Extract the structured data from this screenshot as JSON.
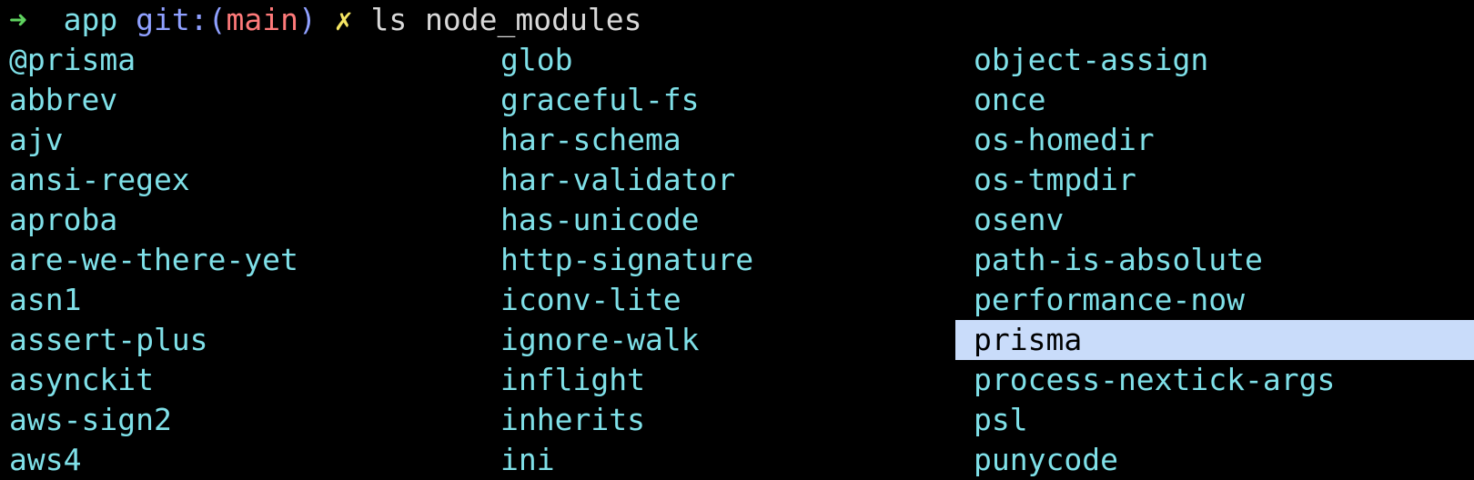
{
  "prompt": {
    "arrow": "➜",
    "directory": "app",
    "git_label": "git:",
    "paren_open": "(",
    "branch": "main",
    "paren_close": ")",
    "dirty_marker": "✗",
    "command": "ls node_modules"
  },
  "listing": {
    "column_1": [
      "@prisma",
      "abbrev",
      "ajv",
      "ansi-regex",
      "aproba",
      "are-we-there-yet",
      "asn1",
      "assert-plus",
      "asynckit",
      "aws-sign2",
      "aws4"
    ],
    "column_2": [
      "glob",
      "graceful-fs",
      "har-schema",
      "har-validator",
      "has-unicode",
      "http-signature",
      "iconv-lite",
      "ignore-walk",
      "inflight",
      "inherits",
      "ini"
    ],
    "column_3": [
      "object-assign",
      "once",
      "os-homedir",
      "os-tmpdir",
      "osenv",
      "path-is-absolute",
      "performance-now",
      "prisma",
      "process-nextick-args",
      "psl",
      "punycode"
    ],
    "selected_entry": "prisma"
  },
  "colors": {
    "background": "#000000",
    "entry_text": "#7fe0e8",
    "selection_background": "#c9dcfa",
    "arrow": "#5fd35f",
    "branch": "#ff7a7a",
    "git_label": "#8fa0ff",
    "dirty_marker": "#f5e663"
  }
}
